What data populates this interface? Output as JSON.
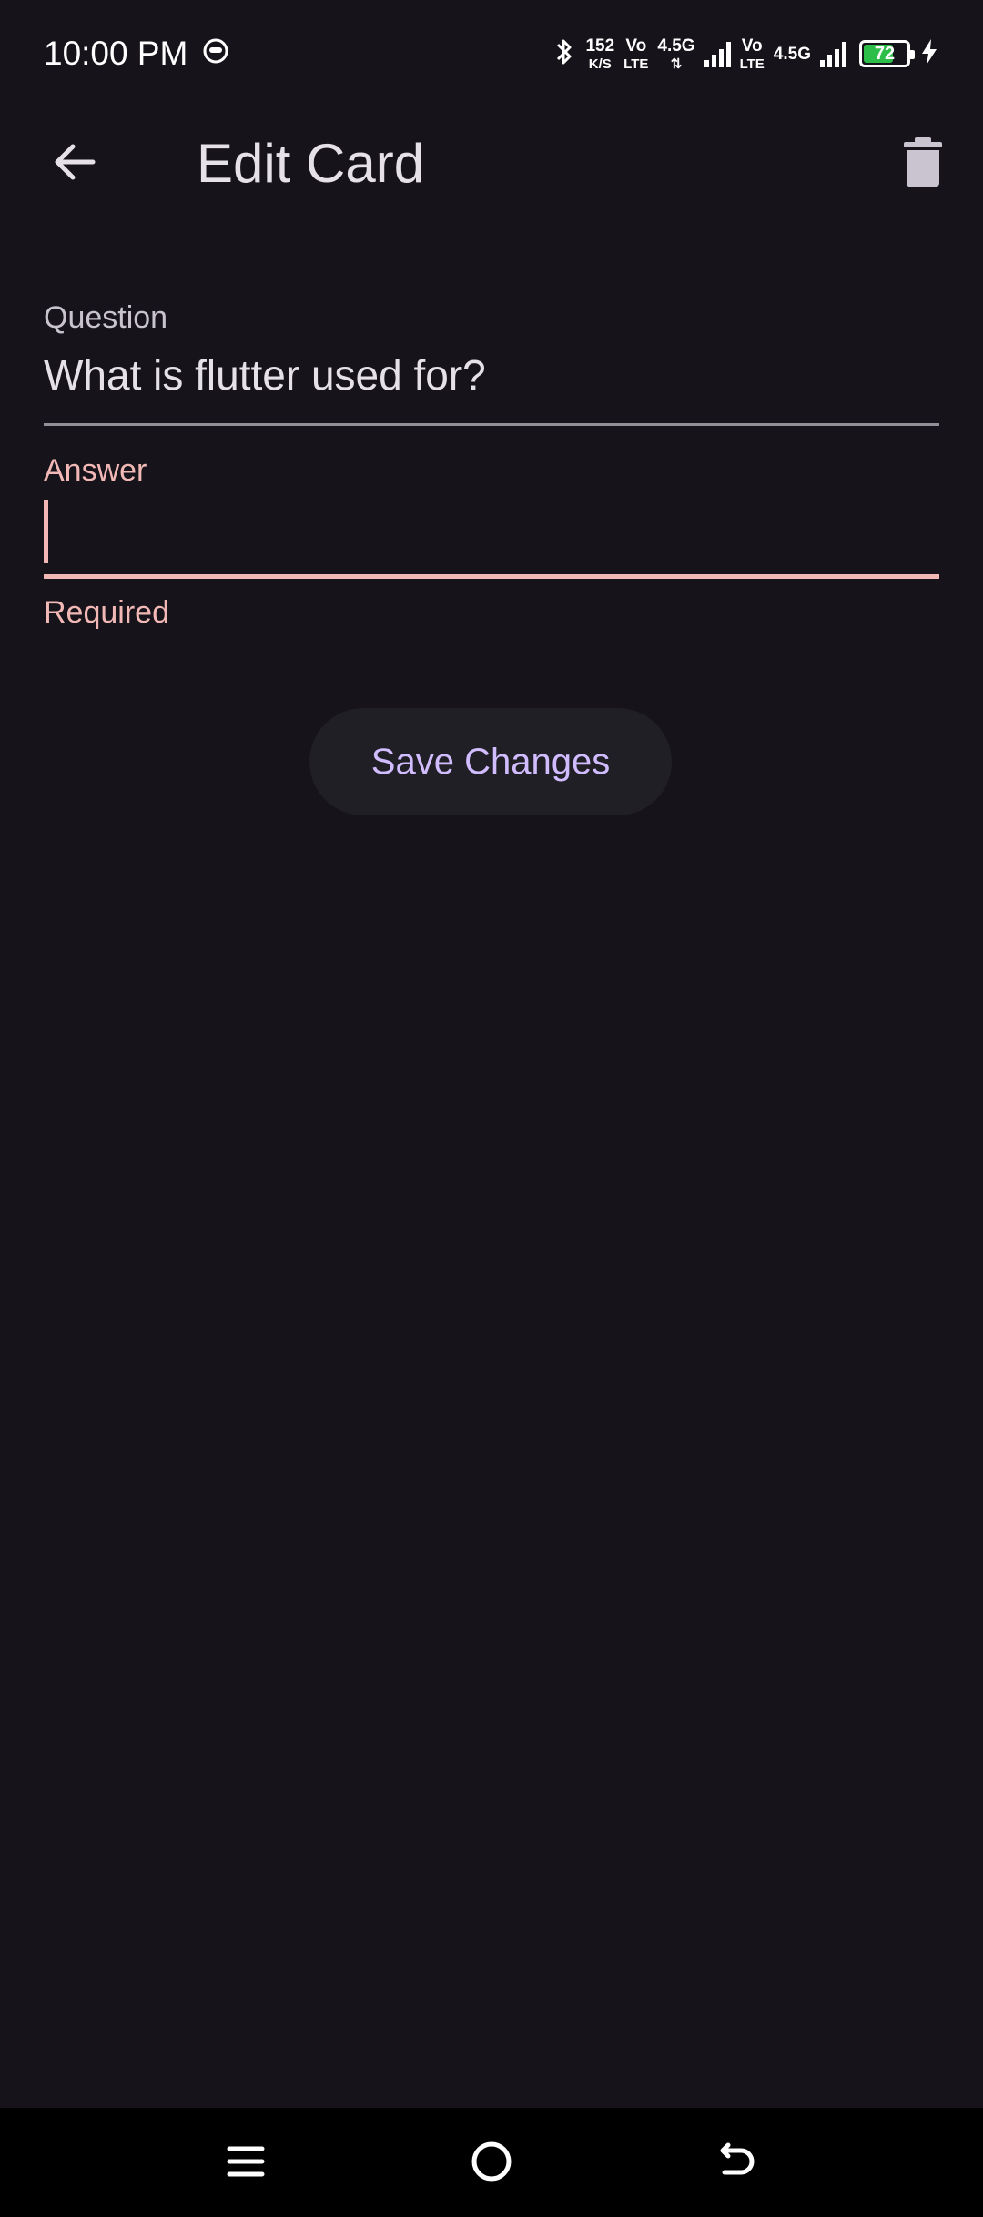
{
  "status_bar": {
    "time": "10:00 PM",
    "speed_value": "152",
    "speed_unit": "K/S",
    "sim1_top": "Vo",
    "sim1_bottom": "LTE",
    "net1": "4.5G",
    "sim2_top": "Vo",
    "sim2_bottom": "LTE",
    "net2": "4.5G",
    "battery": "72",
    "battery_level": 0.72,
    "battery_color": "#2dbe4a"
  },
  "app_bar": {
    "title": "Edit Card",
    "back_icon": "arrow-left-icon",
    "delete_icon": "trash-icon"
  },
  "form": {
    "question_label": "Question",
    "question_value": "What is flutter used for?",
    "answer_label": "Answer",
    "answer_value": "",
    "answer_error": "Required"
  },
  "actions": {
    "save_label": "Save Changes"
  },
  "nav_bar": {
    "recents_icon": "menu-icon",
    "home_icon": "circle-icon",
    "back_icon": "back-arrow-icon"
  },
  "colors": {
    "background": "#16141a",
    "error": "#f2b8b5",
    "accent": "#d0bcff"
  }
}
